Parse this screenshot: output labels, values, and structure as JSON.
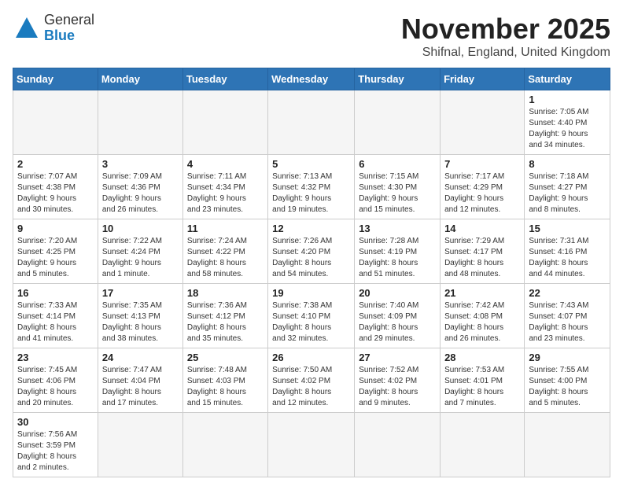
{
  "logo": {
    "line1": "General",
    "line2": "Blue"
  },
  "title": "November 2025",
  "location": "Shifnal, England, United Kingdom",
  "weekdays": [
    "Sunday",
    "Monday",
    "Tuesday",
    "Wednesday",
    "Thursday",
    "Friday",
    "Saturday"
  ],
  "days": [
    {
      "date": null,
      "info": ""
    },
    {
      "date": null,
      "info": ""
    },
    {
      "date": null,
      "info": ""
    },
    {
      "date": null,
      "info": ""
    },
    {
      "date": null,
      "info": ""
    },
    {
      "date": null,
      "info": ""
    },
    {
      "date": "1",
      "info": "Sunrise: 7:05 AM\nSunset: 4:40 PM\nDaylight: 9 hours\nand 34 minutes."
    },
    {
      "date": "2",
      "info": "Sunrise: 7:07 AM\nSunset: 4:38 PM\nDaylight: 9 hours\nand 30 minutes."
    },
    {
      "date": "3",
      "info": "Sunrise: 7:09 AM\nSunset: 4:36 PM\nDaylight: 9 hours\nand 26 minutes."
    },
    {
      "date": "4",
      "info": "Sunrise: 7:11 AM\nSunset: 4:34 PM\nDaylight: 9 hours\nand 23 minutes."
    },
    {
      "date": "5",
      "info": "Sunrise: 7:13 AM\nSunset: 4:32 PM\nDaylight: 9 hours\nand 19 minutes."
    },
    {
      "date": "6",
      "info": "Sunrise: 7:15 AM\nSunset: 4:30 PM\nDaylight: 9 hours\nand 15 minutes."
    },
    {
      "date": "7",
      "info": "Sunrise: 7:17 AM\nSunset: 4:29 PM\nDaylight: 9 hours\nand 12 minutes."
    },
    {
      "date": "8",
      "info": "Sunrise: 7:18 AM\nSunset: 4:27 PM\nDaylight: 9 hours\nand 8 minutes."
    },
    {
      "date": "9",
      "info": "Sunrise: 7:20 AM\nSunset: 4:25 PM\nDaylight: 9 hours\nand 5 minutes."
    },
    {
      "date": "10",
      "info": "Sunrise: 7:22 AM\nSunset: 4:24 PM\nDaylight: 9 hours\nand 1 minute."
    },
    {
      "date": "11",
      "info": "Sunrise: 7:24 AM\nSunset: 4:22 PM\nDaylight: 8 hours\nand 58 minutes."
    },
    {
      "date": "12",
      "info": "Sunrise: 7:26 AM\nSunset: 4:20 PM\nDaylight: 8 hours\nand 54 minutes."
    },
    {
      "date": "13",
      "info": "Sunrise: 7:28 AM\nSunset: 4:19 PM\nDaylight: 8 hours\nand 51 minutes."
    },
    {
      "date": "14",
      "info": "Sunrise: 7:29 AM\nSunset: 4:17 PM\nDaylight: 8 hours\nand 48 minutes."
    },
    {
      "date": "15",
      "info": "Sunrise: 7:31 AM\nSunset: 4:16 PM\nDaylight: 8 hours\nand 44 minutes."
    },
    {
      "date": "16",
      "info": "Sunrise: 7:33 AM\nSunset: 4:14 PM\nDaylight: 8 hours\nand 41 minutes."
    },
    {
      "date": "17",
      "info": "Sunrise: 7:35 AM\nSunset: 4:13 PM\nDaylight: 8 hours\nand 38 minutes."
    },
    {
      "date": "18",
      "info": "Sunrise: 7:36 AM\nSunset: 4:12 PM\nDaylight: 8 hours\nand 35 minutes."
    },
    {
      "date": "19",
      "info": "Sunrise: 7:38 AM\nSunset: 4:10 PM\nDaylight: 8 hours\nand 32 minutes."
    },
    {
      "date": "20",
      "info": "Sunrise: 7:40 AM\nSunset: 4:09 PM\nDaylight: 8 hours\nand 29 minutes."
    },
    {
      "date": "21",
      "info": "Sunrise: 7:42 AM\nSunset: 4:08 PM\nDaylight: 8 hours\nand 26 minutes."
    },
    {
      "date": "22",
      "info": "Sunrise: 7:43 AM\nSunset: 4:07 PM\nDaylight: 8 hours\nand 23 minutes."
    },
    {
      "date": "23",
      "info": "Sunrise: 7:45 AM\nSunset: 4:06 PM\nDaylight: 8 hours\nand 20 minutes."
    },
    {
      "date": "24",
      "info": "Sunrise: 7:47 AM\nSunset: 4:04 PM\nDaylight: 8 hours\nand 17 minutes."
    },
    {
      "date": "25",
      "info": "Sunrise: 7:48 AM\nSunset: 4:03 PM\nDaylight: 8 hours\nand 15 minutes."
    },
    {
      "date": "26",
      "info": "Sunrise: 7:50 AM\nSunset: 4:02 PM\nDaylight: 8 hours\nand 12 minutes."
    },
    {
      "date": "27",
      "info": "Sunrise: 7:52 AM\nSunset: 4:02 PM\nDaylight: 8 hours\nand 9 minutes."
    },
    {
      "date": "28",
      "info": "Sunrise: 7:53 AM\nSunset: 4:01 PM\nDaylight: 8 hours\nand 7 minutes."
    },
    {
      "date": "29",
      "info": "Sunrise: 7:55 AM\nSunset: 4:00 PM\nDaylight: 8 hours\nand 5 minutes."
    },
    {
      "date": "30",
      "info": "Sunrise: 7:56 AM\nSunset: 3:59 PM\nDaylight: 8 hours\nand 2 minutes."
    },
    {
      "date": null,
      "info": ""
    },
    {
      "date": null,
      "info": ""
    },
    {
      "date": null,
      "info": ""
    },
    {
      "date": null,
      "info": ""
    },
    {
      "date": null,
      "info": ""
    },
    {
      "date": null,
      "info": ""
    }
  ]
}
